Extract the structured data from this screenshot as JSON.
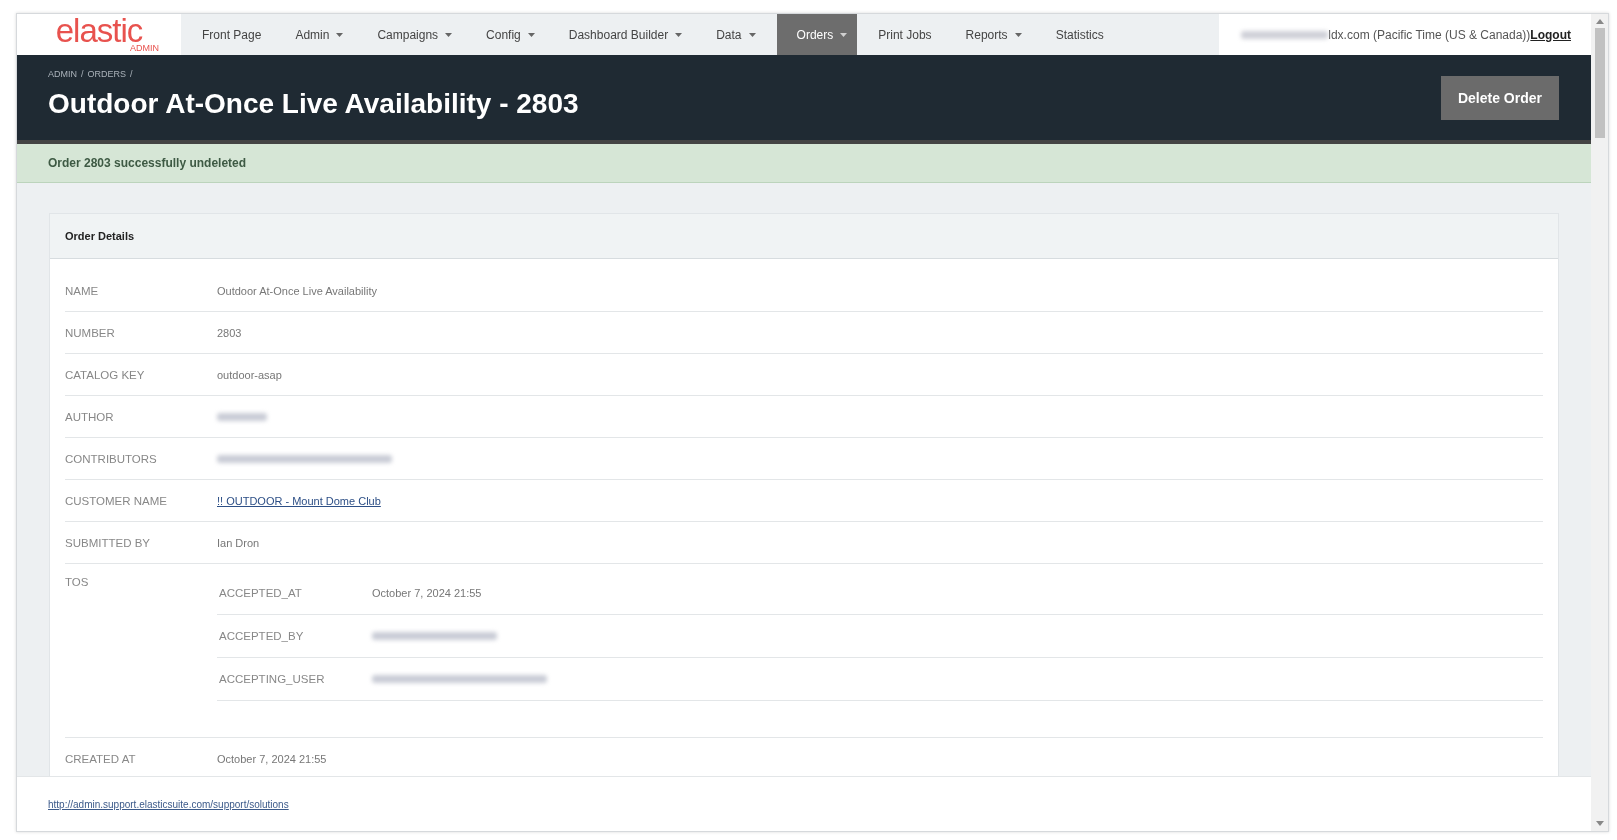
{
  "logo": {
    "name": "elastic",
    "sub": "ADMIN"
  },
  "nav": [
    {
      "label": "Front Page",
      "dropdown": false,
      "selected": false
    },
    {
      "label": "Admin",
      "dropdown": true,
      "selected": false
    },
    {
      "label": "Campaigns",
      "dropdown": true,
      "selected": false
    },
    {
      "label": "Config",
      "dropdown": true,
      "selected": false
    },
    {
      "label": "Dashboard Builder",
      "dropdown": true,
      "selected": false
    },
    {
      "label": "Data",
      "dropdown": true,
      "selected": false
    },
    {
      "label": "Orders",
      "dropdown": true,
      "selected": true
    },
    {
      "label": "Print Jobs",
      "dropdown": false,
      "selected": false
    },
    {
      "label": "Reports",
      "dropdown": true,
      "selected": false
    },
    {
      "label": "Statistics",
      "dropdown": false,
      "selected": false
    }
  ],
  "user": {
    "email_redacted": true,
    "text": "ldx.com (Pacific Time (US & Canada))",
    "logout": "Logout"
  },
  "breadcrumb": [
    "ADMIN",
    "/",
    "ORDERS",
    "/"
  ],
  "title": "Outdoor At-Once Live Availability - 2803",
  "delete_button": "Delete Order",
  "alert": "Order 2803 successfully undeleted",
  "card": {
    "title": "Order Details",
    "rows": [
      {
        "label": "NAME",
        "kind": "text",
        "value": "Outdoor At-Once Live Availability"
      },
      {
        "label": "NUMBER",
        "kind": "text",
        "value": "2803"
      },
      {
        "label": "CATALOG KEY",
        "kind": "text",
        "value": "outdoor-asap"
      },
      {
        "label": "AUTHOR",
        "kind": "redacted"
      },
      {
        "label": "CONTRIBUTORS",
        "kind": "redacted"
      },
      {
        "label": "CUSTOMER NAME",
        "kind": "link",
        "value": "!! OUTDOOR - Mount Dome Club"
      },
      {
        "label": "SUBMITTED BY",
        "kind": "text",
        "value": "Ian Dron"
      },
      {
        "label": "TOS",
        "kind": "group",
        "children": [
          {
            "label": "ACCEPTED_AT",
            "kind": "text",
            "value": "October 7, 2024 21:55"
          },
          {
            "label": "ACCEPTED_BY",
            "kind": "redacted"
          },
          {
            "label": "ACCEPTING_USER",
            "kind": "redacted"
          }
        ]
      },
      {
        "label": "CREATED AT",
        "kind": "text",
        "value": "October 7, 2024 21:55"
      }
    ]
  },
  "footer_link": "http://admin.support.elasticsuite.com/support/solutions"
}
